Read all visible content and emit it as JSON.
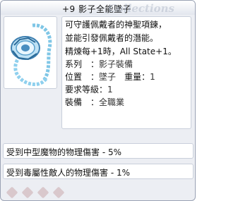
{
  "window": {
    "title": "+9 影子全能墜子",
    "watermark": "Collections"
  },
  "item": {
    "icon": "shadow-pendant-icon",
    "description_lines": [
      "可守護佩戴者的神聖項鍊，",
      "並能引發佩戴者的潛能。",
      "精煉每+1時，All State+1。"
    ],
    "type_label": "系列",
    "type_value": "影子裝備",
    "position_label": "位置",
    "position_value": "墜子",
    "weight_label": "重量",
    "weight_value": "1",
    "level_label": "要求等級",
    "level_value": "1",
    "equip_label": "裝備",
    "equip_value": "全職業"
  },
  "enchants": [
    "受到中型魔物的物理傷害 - 5%",
    "受到毒屬性敵人的物理傷害 - 1%"
  ],
  "slots_count": 4
}
